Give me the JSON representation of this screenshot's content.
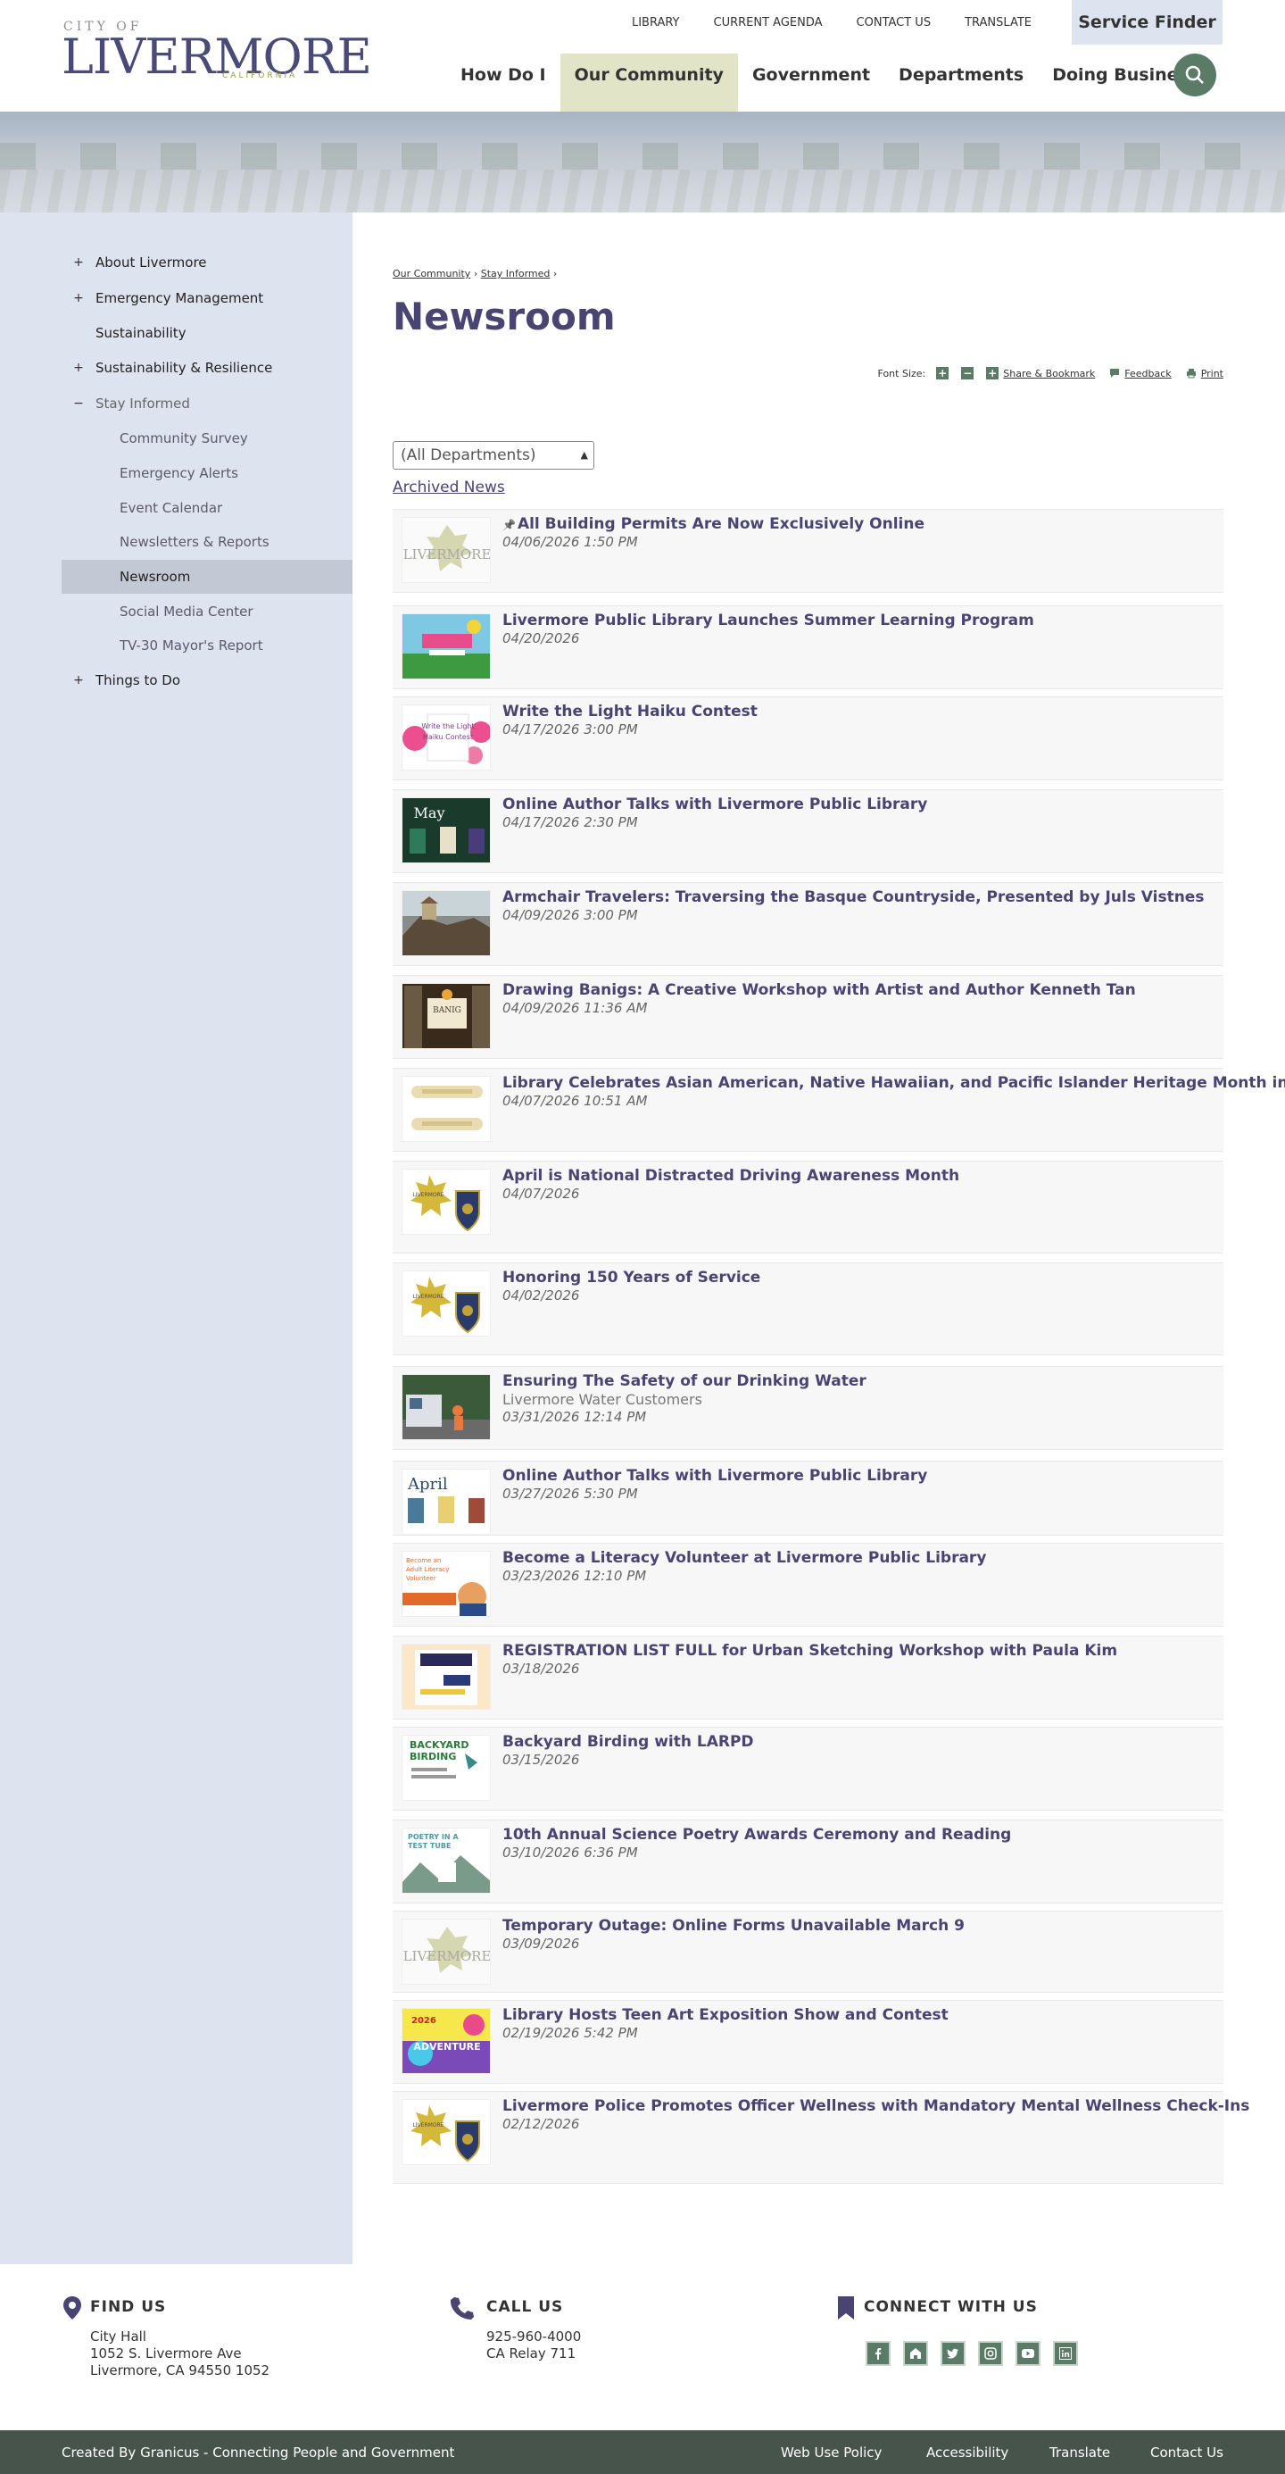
{
  "logo": {
    "city": "CITY OF",
    "name": "LIVERMORE",
    "state": "CALIFORNIA"
  },
  "utility_nav": [
    "LIBRARY",
    "CURRENT AGENDA",
    "CONTACT US",
    "TRANSLATE"
  ],
  "service_finder": "Service Finder",
  "main_nav": [
    {
      "label": "How Do I",
      "active": false
    },
    {
      "label": "Our Community",
      "active": true
    },
    {
      "label": "Government",
      "active": false
    },
    {
      "label": "Departments",
      "active": false
    },
    {
      "label": "Doing Business",
      "active": false
    }
  ],
  "sidebar": {
    "items": [
      {
        "label": "About Livermore",
        "toggle": "+"
      },
      {
        "label": "Emergency Management",
        "toggle": "+"
      },
      {
        "label": "Sustainability",
        "toggle": ""
      },
      {
        "label": "Sustainability & Resilience",
        "toggle": "+"
      },
      {
        "label": "Stay Informed",
        "toggle": "−"
      },
      {
        "label": "Things to Do",
        "toggle": "+"
      }
    ],
    "sub_items": [
      "Community Survey",
      "Emergency Alerts",
      "Event Calendar",
      "Newsletters & Reports",
      "Newsroom",
      "Social Media Center",
      "TV-30 Mayor's Report"
    ],
    "active_sub": "Newsroom"
  },
  "breadcrumb": {
    "items": [
      "Our Community",
      "Stay Informed"
    ],
    "separator": "›"
  },
  "page_title": "Newsroom",
  "tools": {
    "font_size_label": "Font Size:",
    "share": "Share & Bookmark",
    "feedback": "Feedback",
    "print": "Print"
  },
  "department_select": {
    "value": "(All Departments)"
  },
  "archived_link": "Archived News",
  "news": [
    {
      "title": "All Building Permits Are Now Exclusively Online",
      "date": "04/06/2026 1:50 PM",
      "pinned": true,
      "thumb": "livermore-logo"
    },
    {
      "title": "Livermore Public Library Launches Summer Learning Program",
      "date": "04/20/2026",
      "thumb": "summer-learning"
    },
    {
      "title": "Write the Light Haiku Contest",
      "date": "04/17/2026 3:00 PM",
      "thumb": "haiku-contest"
    },
    {
      "title": "Online Author Talks with Livermore Public Library",
      "date": "04/17/2026 2:30 PM",
      "thumb": "author-talks-may"
    },
    {
      "title": "Armchair Travelers: Traversing the Basque Countryside, Presented by Juls Vistnes",
      "date": "04/09/2026 3:00 PM",
      "thumb": "basque-coast"
    },
    {
      "title": "Drawing Banigs: A Creative Workshop with Artist and Author Kenneth Tan",
      "date": "04/09/2026 11:36 AM",
      "thumb": "banig-workshop"
    },
    {
      "title": "Library Celebrates Asian American, Native Hawaiian, and Pacific Islander Heritage Month in May",
      "date": "04/07/2026 10:51 AM",
      "thumb": "heritage-month"
    },
    {
      "title": "April is National Distracted Driving Awareness Month",
      "date": "04/07/2026",
      "thumb": "police-badge"
    },
    {
      "title": "Honoring 150 Years of Service",
      "date": "04/02/2026",
      "thumb": "police-badge"
    },
    {
      "title": "Ensuring The Safety of our Drinking Water",
      "subtitle": "Livermore Water Customers",
      "date": "03/31/2026 12:14 PM",
      "thumb": "water-crew"
    },
    {
      "title": "Online Author Talks with Livermore Public Library",
      "date": "03/27/2026 5:30 PM",
      "thumb": "author-talks-april"
    },
    {
      "title": "Become a Literacy Volunteer at Livermore Public Library",
      "date": "03/23/2026 12:10 PM",
      "thumb": "literacy-volunteer"
    },
    {
      "title": "REGISTRATION LIST FULL for Urban Sketching Workshop with Paula Kim",
      "date": "03/18/2026",
      "thumb": "urban-sketching"
    },
    {
      "title": "Backyard Birding with LARPD",
      "date": "03/15/2026",
      "thumb": "backyard-birding"
    },
    {
      "title": "10th Annual Science Poetry Awards Ceremony and Reading",
      "date": "03/10/2026 6:36 PM",
      "thumb": "poetry-test-tube"
    },
    {
      "title": "Temporary Outage: Online Forms Unavailable March 9",
      "date": "03/09/2026",
      "thumb": "livermore-logo"
    },
    {
      "title": "Library Hosts Teen Art Exposition Show and Contest",
      "date": "02/19/2026 5:42 PM",
      "thumb": "teen-art"
    },
    {
      "title": "Livermore Police Promotes Officer Wellness with Mandatory Mental Wellness Check-Ins",
      "date": "02/12/2026",
      "thumb": "police-badge"
    }
  ],
  "thumb_text": {
    "haiku": "Write the Light Haiku Contest",
    "may": "May",
    "banig": "BANIG",
    "april": "April",
    "literacy": "Become an Adult Literacy Volunteer",
    "sketch": "URBAN SKETCHING WORKSHOP",
    "birding": "BACKYARD BIRDING",
    "poetry": "POETRY IN A TEST TUBE",
    "teen_year": "2026",
    "teen_word": "ADVENTURE"
  },
  "footer": {
    "find_us": {
      "heading": "FIND US",
      "lines": [
        "City Hall",
        "1052 S. Livermore Ave",
        "Livermore, CA 94550 1052"
      ]
    },
    "call_us": {
      "heading": "CALL US",
      "lines": [
        "925-960-4000",
        "CA Relay 711"
      ]
    },
    "connect": {
      "heading": "CONNECT WITH US",
      "icons": [
        "facebook-icon",
        "nextdoor-icon",
        "twitter-icon",
        "instagram-icon",
        "youtube-icon",
        "linkedin-icon"
      ]
    }
  },
  "bottom_bar": {
    "credit": "Created By Granicus - Connecting People and Government",
    "links": [
      "Web Use Policy",
      "Accessibility",
      "Translate",
      "Contact Us"
    ]
  },
  "colors": {
    "accent_green": "#5a7c67",
    "title_purple": "#4a4472",
    "sidebar_bg": "#dde3ef",
    "nav_active": "#e2e4c8",
    "footer_bar": "#47544c"
  }
}
